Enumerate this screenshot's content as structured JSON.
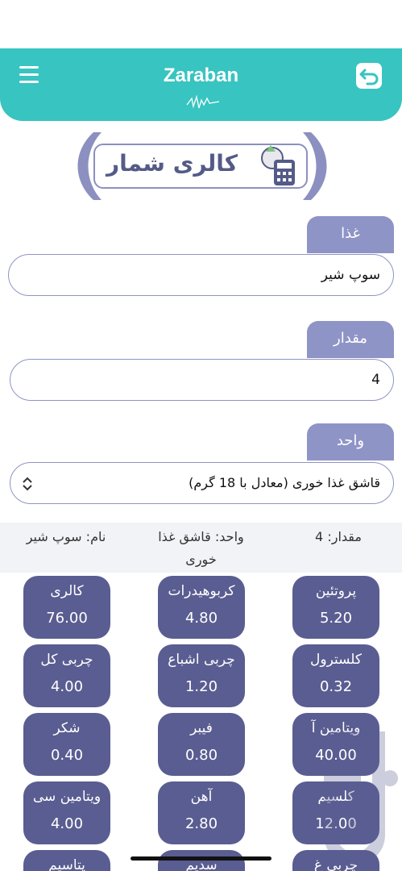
{
  "header": {
    "title": "Zaraban",
    "bg_color": "#38c4c0",
    "menu_icon": "hamburger-menu-icon",
    "back_icon": "back-arrow-icon"
  },
  "logo": {
    "text": "کالری شمار",
    "icon": "food-calculator-icon"
  },
  "form": {
    "food": {
      "label": "غذا",
      "value": "سوپ شیر"
    },
    "amount": {
      "label": "مقدار",
      "value": "4"
    },
    "unit": {
      "label": "واحد",
      "value": "قاشق غذا خوری (معادل با 18 گرم)"
    }
  },
  "summary": {
    "amount": "مقدار: 4",
    "unit": "واحد: قاشق غذا خوری",
    "name": "نام: سوپ شیر"
  },
  "nutrients": [
    {
      "label": "پروتئین",
      "value": "5.20"
    },
    {
      "label": "کربوهیدرات",
      "value": "4.80"
    },
    {
      "label": "کالری",
      "value": "76.00"
    },
    {
      "label": "کلسترول",
      "value": "0.32"
    },
    {
      "label": "چربی اشباع",
      "value": "1.20"
    },
    {
      "label": "چربی کل",
      "value": "4.00"
    },
    {
      "label": "ویتامین آ",
      "value": "40.00"
    },
    {
      "label": "فیبر",
      "value": "0.80"
    },
    {
      "label": "شکر",
      "value": "0.40"
    },
    {
      "label": "کلسیم",
      "value": "12.00"
    },
    {
      "label": "آهن",
      "value": "2.80"
    },
    {
      "label": "ویتامین سی",
      "value": "4.00"
    },
    {
      "label": "چربی غ",
      "value": ""
    },
    {
      "label": "سدیم",
      "value": ""
    },
    {
      "label": "پتاسیم",
      "value": ""
    }
  ],
  "colors": {
    "accent": "#38c4c0",
    "label_tab": "#8f94c6",
    "card": "#5a5d91"
  }
}
